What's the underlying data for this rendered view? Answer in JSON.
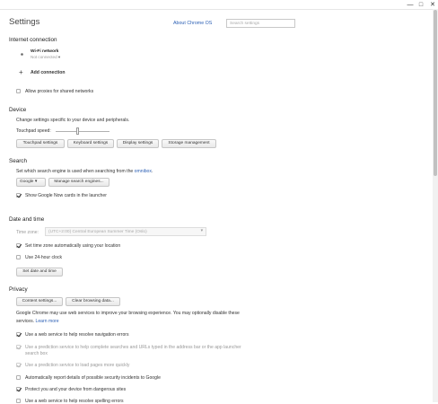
{
  "window": {
    "min_glyph": "—",
    "max_glyph": "□",
    "close_glyph": "✕"
  },
  "header": {
    "title": "Settings",
    "about_link": "About Chrome OS",
    "search_placeholder": "Search settings"
  },
  "internet": {
    "heading": "Internet connection",
    "network_name": "Wi-Fi network",
    "network_status": "Not connected",
    "add_connection": "Add connection",
    "allow_proxies": "Allow proxies for shared networks"
  },
  "device": {
    "heading": "Device",
    "description": "Change settings specific to your device and peripherals.",
    "touchpad_speed_label": "Touchpad speed:",
    "touchpad_speed_value": 0.4,
    "buttons": [
      "Touchpad settings",
      "Keyboard settings",
      "Display settings",
      "Storage management"
    ]
  },
  "search": {
    "heading": "Search",
    "description_prefix": "Set which search engine is used when searching from the ",
    "omnibox_link": "omnibox",
    "description_suffix": ".",
    "engine_selected": "Google",
    "manage_button": "Manage search engines...",
    "google_now": "Show Google Now cards in the launcher"
  },
  "datetime": {
    "heading": "Date and time",
    "timezone_label": "Time zone:",
    "timezone_value": "(UTC+2:00) Central European Summer Time (Oslo)",
    "auto_timezone": "Set time zone automatically using your location",
    "use_24h": "Use 24-hour clock",
    "set_button": "Set date and time"
  },
  "privacy": {
    "heading": "Privacy",
    "content_button": "Content settings...",
    "clear_button": "Clear browsing data...",
    "desc_line1": "Google Chrome may use web services to improve your browsing experience. You may optionally disable these",
    "desc_line2_prefix": "services. ",
    "learn_more": "Learn more",
    "opt1": "Use a web service to help resolve navigation errors",
    "opt2_line1": "Use a prediction service to help complete searches and URLs typed in the address bar or the app launcher",
    "opt2_line2": "search box",
    "opt3": "Use a prediction service to load pages more quickly",
    "opt4": "Automatically report details of possible security incidents to Google",
    "opt5": "Protect you and your device from dangerous sites",
    "opt6": "Use a web service to help resolve spelling errors"
  }
}
